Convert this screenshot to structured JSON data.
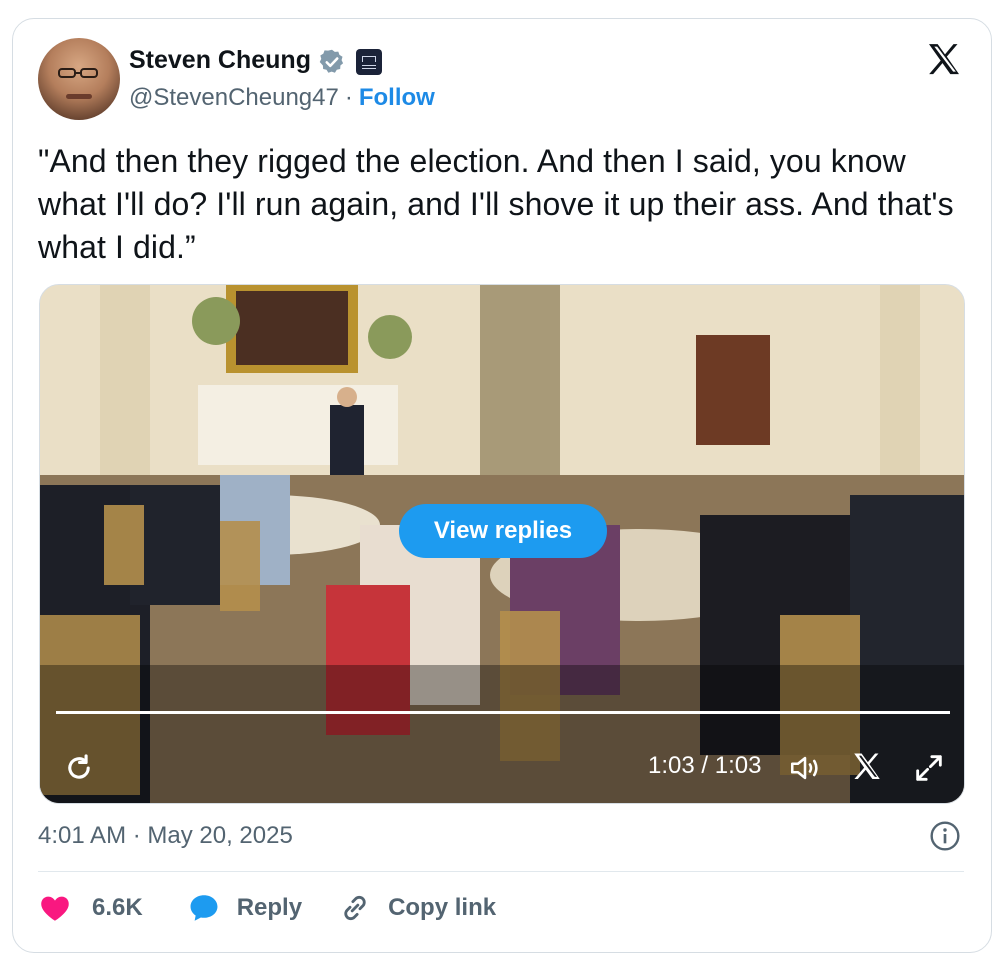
{
  "author": {
    "name": "Steven Cheung",
    "handle": "@StevenCheung47",
    "separator": "·",
    "follow_label": "Follow"
  },
  "tweet": {
    "text": "\"And then they rigged the election. And then I said, you know what I'll do? I'll run again, and I'll shove it up their ass. And that's what I did.”"
  },
  "video": {
    "view_replies_label": "View replies",
    "time_display": "1:03 / 1:03",
    "progress": 1.0
  },
  "meta": {
    "timestamp": "4:01 AM · May 20, 2025"
  },
  "actions": {
    "like_count": "6.6K",
    "reply_label": "Reply",
    "copy_link_label": "Copy link"
  },
  "colors": {
    "accent": "#1d9bf0",
    "follow": "#1d8ae6",
    "like": "#f91880",
    "secondary_text": "#536471"
  }
}
